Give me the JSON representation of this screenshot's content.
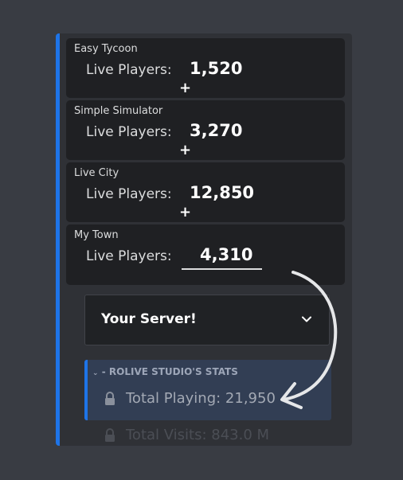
{
  "games": [
    {
      "name": "Easy Tycoon",
      "players_label": "Live Players:",
      "players": "1,520",
      "marker": "+"
    },
    {
      "name": "Simple Simulator",
      "players_label": "Live Players:",
      "players": "3,270",
      "marker": "+"
    },
    {
      "name": "Live City",
      "players_label": "Live Players:",
      "players": "12,850",
      "marker": "+"
    },
    {
      "name": "My Town",
      "players_label": "Live Players:",
      "players": "4,310"
    }
  ],
  "server_select": {
    "label": "Your Server!",
    "icon": "chevron-down-icon"
  },
  "stats": {
    "header": "- ROLIVE STUDIO'S STATS",
    "items": [
      {
        "label": "Total Playing: 21,950",
        "icon": "lock-icon"
      },
      {
        "label": "Total Visits: 843.0 M",
        "icon": "lock-icon"
      }
    ]
  },
  "colors": {
    "background": "#393c43",
    "embed": "#2f3136",
    "accent": "#1e74e8",
    "card": "#1f2023",
    "stats_panel": "#323e54"
  }
}
